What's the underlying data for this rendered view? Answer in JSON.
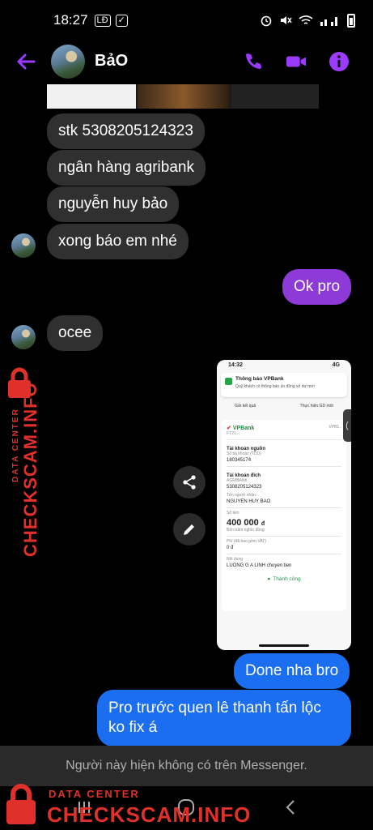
{
  "status_bar": {
    "time": "18:27",
    "left_icons": [
      "LĐ",
      "✓"
    ],
    "right_icons": [
      "alarm-icon",
      "mute-icon",
      "wifi-icon",
      "signal-icon",
      "battery-icon"
    ]
  },
  "header": {
    "contact_name": "BảO",
    "accent_color": "#9b3bff"
  },
  "messages": [
    {
      "id": "m1",
      "direction": "in",
      "text": "stk 5308205124323"
    },
    {
      "id": "m2",
      "direction": "in",
      "text": "ngân hàng agribank"
    },
    {
      "id": "m3",
      "direction": "in",
      "text": "nguyễn huy bảo"
    },
    {
      "id": "m4",
      "direction": "in",
      "text": "xong báo em nhé"
    },
    {
      "id": "m5",
      "direction": "out",
      "text": "Ok pro"
    },
    {
      "id": "m6",
      "direction": "in",
      "text": "ocee"
    },
    {
      "id": "m7",
      "direction": "out",
      "text": "Done nha bro"
    },
    {
      "id": "m8",
      "direction": "out",
      "text": "Pro trước quen lê thanh tấn lộc ko fix á"
    }
  ],
  "receipt": {
    "time": "14:32",
    "network": "4G",
    "notification_title": "Thông báo VPBank",
    "notification_text": "Quý khách có thông báo ủn động số dư mới",
    "action_left": "Gửi kết quả",
    "action_right": "Thực hiện GD mới",
    "bank_name": "VPBank",
    "ref_left": "FT21...",
    "ref_right": "VPB1..",
    "source_label": "Tài khoản nguồn",
    "source_sub": "Số tài khoản (TDD)",
    "source_account": "180345174",
    "dest_label": "Tài khoản đích",
    "dest_sub": "AGRIBANK",
    "dest_account": "5308205124323",
    "receiver_sub": "Tên người nhận",
    "receiver_name": "NGUYEN HUY BAO",
    "amount_sub": "Số tiền",
    "amount": "400 000",
    "currency": "đ",
    "amount_words": "Bốn trăm nghìn đồng",
    "fee_sub": "Phí (đã bao gồm VAT)",
    "fee": "0 đ",
    "note_sub": "Nội dung",
    "note": "LUONG G A LINH chuyen tien",
    "status": "Thành công"
  },
  "footer": {
    "unavailable_text": "Người này hiện không có trên Messenger."
  },
  "watermark": {
    "data_center": "DATA CENTER",
    "site": "CHECKSCAM.INFO",
    "color": "#e0302a"
  }
}
